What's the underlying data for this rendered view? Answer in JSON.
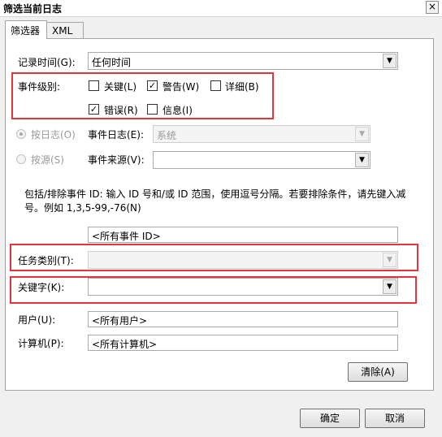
{
  "window": {
    "title": "筛选当前日志",
    "close": "×"
  },
  "tabs": [
    {
      "label": "筛选器"
    },
    {
      "label": "XML"
    }
  ],
  "logged": {
    "label": "记录时间(G):",
    "value": "任何时间"
  },
  "event_level": {
    "label": "事件级别:",
    "critical": {
      "label": "关键(L)",
      "checked": false
    },
    "warning": {
      "label": "警告(W)",
      "checked": true
    },
    "verbose": {
      "label": "详细(B)",
      "checked": false
    },
    "error": {
      "label": "错误(R)",
      "checked": true
    },
    "information": {
      "label": "信息(I)",
      "checked": false
    }
  },
  "by_log": {
    "label": "按日志(O)",
    "field_label": "事件日志(E):",
    "value": "系统"
  },
  "by_source": {
    "label": "按源(S)",
    "field_label": "事件来源(V):",
    "value": ""
  },
  "description": "包括/排除事件 ID: 输入 ID 号和/或 ID 范围，使用逗号分隔。若要排除条件，请先键入减号。例如 1,3,5-99,-76(N)",
  "event_ids": {
    "value": "<所有事件 ID>"
  },
  "task_category": {
    "label": "任务类别(T):",
    "value": ""
  },
  "keywords": {
    "label": "关键字(K):",
    "value": ""
  },
  "user": {
    "label": "用户(U):",
    "value": "<所有用户>"
  },
  "computer": {
    "label": "计算机(P):",
    "value": "<所有计算机>"
  },
  "buttons": {
    "clear": "清除(A)",
    "ok": "确定",
    "cancel": "取消"
  },
  "colors": {
    "highlight": "#e0363c"
  }
}
